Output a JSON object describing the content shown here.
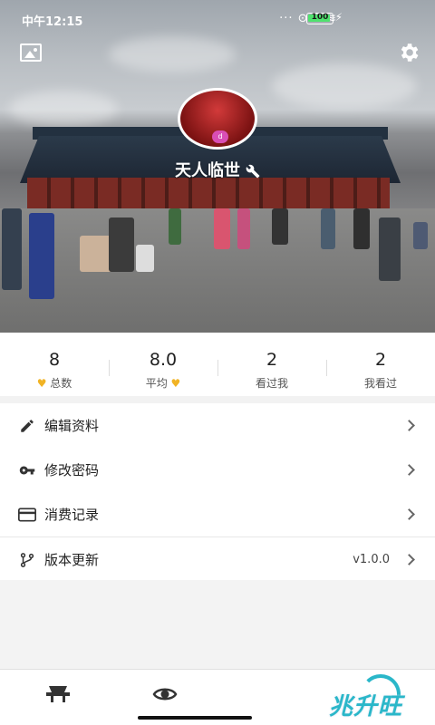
{
  "status_bar": {
    "time": "中午12:15",
    "indicators": "··· ⊙ ⅲ ≋",
    "battery": "100",
    "charging": "⚡"
  },
  "header": {
    "left_icon": "image-icon",
    "right_icon": "gear-icon",
    "avatar_badge": "d",
    "username": "天人临世",
    "username_icon": "wrench-icon"
  },
  "stats": [
    {
      "value": "8",
      "label": "总数",
      "heart": "left"
    },
    {
      "value": "8.0",
      "label": "平均",
      "heart": "right"
    },
    {
      "value": "2",
      "label": "看过我",
      "heart": "none"
    },
    {
      "value": "2",
      "label": "我看过",
      "heart": "none"
    }
  ],
  "menu": [
    {
      "icon": "pencil-icon",
      "label": "编辑资料",
      "value": ""
    },
    {
      "icon": "key-icon",
      "label": "修改密码",
      "value": ""
    },
    {
      "icon": "card-icon",
      "label": "消费记录",
      "value": ""
    },
    {
      "icon": "branch-icon",
      "label": "版本更新",
      "value": "v1.0.0"
    }
  ],
  "tabbar": {
    "tabs": [
      "home-icon",
      "eye-icon"
    ],
    "brand": "兆升旺"
  },
  "colors": {
    "accent": "#2ab7c9",
    "heart": "#f1b324"
  }
}
